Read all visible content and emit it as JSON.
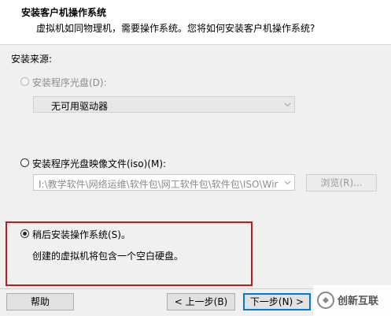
{
  "header": {
    "title": "安装客户机操作系统",
    "subtitle": "虚拟机如同物理机，需要操作系统。您将如何安装客户机操作系统?"
  },
  "source": {
    "label": "安装来源:",
    "disc": {
      "label": "安装程序光盘(D):",
      "selected": false,
      "enabled": false,
      "drive_value": "无可用驱动器"
    },
    "iso": {
      "label": "安装程序光盘映像文件(iso)(M):",
      "selected": false,
      "path_value": "I:\\教学软件\\网络运维\\软件包\\网工软件包\\软件包\\ISO\\Wir",
      "browse_label": "浏览(R)..."
    },
    "later": {
      "label": "稍后安装操作系统(S)。",
      "selected": true,
      "description": "创建的虚拟机将包含一个空白硬盘。"
    }
  },
  "footer": {
    "help_label": "帮助",
    "back_label": "< 上一步(B)",
    "next_label": "下一步(N) >"
  },
  "watermark": {
    "text": "创新互联"
  },
  "colors": {
    "highlight_border": "#c8161d",
    "default_button_border": "#0078d7"
  }
}
